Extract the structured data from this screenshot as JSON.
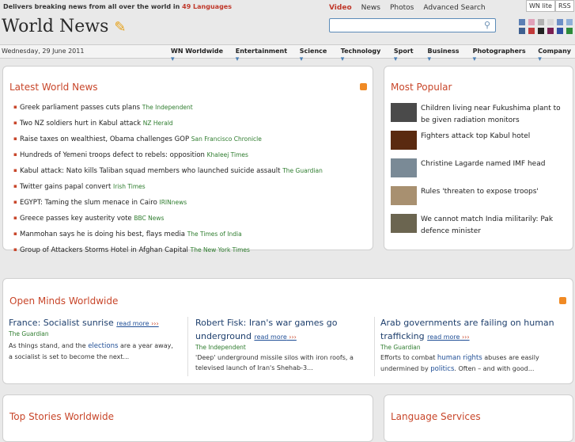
{
  "header": {
    "tagline_prefix": "Delivers breaking news from all over the world in",
    "tagline_highlight": "49 Languages",
    "top_links": [
      "Video",
      "News",
      "Photos",
      "Advanced Search"
    ],
    "lite_label": "WN lite",
    "rss_label": "RSS",
    "logo_text": "World News",
    "search_placeholder": ""
  },
  "theme_swatches": [
    "#5b7fb4",
    "#e0a1b8",
    "#b0b0b0",
    "#d8d8d8",
    "#6d8fc7",
    "#8fb0d8",
    "#3e5f8f",
    "#c23a3a",
    "#222222",
    "#7a1f52",
    "#2f4fa3",
    "#2d8b3a"
  ],
  "nav": {
    "date": "Wednesday, 29 June 2011",
    "items": [
      "WN Worldwide",
      "Entertainment",
      "Science",
      "Technology",
      "Sport",
      "Business",
      "Photographers",
      "Company"
    ]
  },
  "latest": {
    "title": "Latest World News",
    "items": [
      {
        "headline": "Greek parliament passes cuts plans",
        "source": "The Independent"
      },
      {
        "headline": "Two NZ soldiers hurt in Kabul attack",
        "source": "NZ Herald"
      },
      {
        "headline": "Raise taxes on wealthiest, Obama challenges GOP",
        "source": "San Francisco Chronicle"
      },
      {
        "headline": "Hundreds of Yemeni troops defect to rebels: opposition",
        "source": "Khaleej Times"
      },
      {
        "headline": "Kabul attack: Nato kills Taliban squad members who launched suicide assault",
        "source": "The Guardian"
      },
      {
        "headline": "Twitter gains papal convert",
        "source": "Irish Times"
      },
      {
        "headline": "EGYPT: Taming the slum menace in Cairo",
        "source": "IRINnews"
      },
      {
        "headline": "Greece passes key austerity vote",
        "source": "BBC News"
      },
      {
        "headline": "Manmohan says he is doing his best, flays media",
        "source": "The Times of India"
      },
      {
        "headline": "Group of Attackers Storms Hotel in Afghan Capital",
        "source": "The New York Times"
      }
    ]
  },
  "popular": {
    "title": "Most Popular",
    "items": [
      {
        "headline": "Children living near Fukushima plant to be given radiation monitors",
        "thumb_color": "#4a4a4a"
      },
      {
        "headline": "Fighters attack top Kabul hotel",
        "thumb_color": "#5a2a10"
      },
      {
        "headline": "Christine Lagarde named IMF head",
        "thumb_color": "#7a8a96"
      },
      {
        "headline": "Rules 'threaten to expose troops'",
        "thumb_color": "#a89070"
      },
      {
        "headline": "We cannot match India militarily: Pak defence minister",
        "thumb_color": "#6b6550"
      }
    ]
  },
  "open_minds": {
    "title": "Open Minds Worldwide",
    "read_more": "read more",
    "items": [
      {
        "title": "France: Socialist sunrise",
        "source": "The Guardian",
        "text_before": "As things stand, and the ",
        "keyword": "elections",
        "text_after": " are a year away, a socialist is set to become the next..."
      },
      {
        "title": "Robert Fisk: Iran's war games go underground",
        "source": "The Independent",
        "text_before": "'Deep' underground missile silos with iron roofs, a televised launch of Iran's Shehab-3...",
        "keyword": "",
        "text_after": ""
      },
      {
        "title": "Arab governments are failing on human trafficking",
        "source": "The Guardian",
        "text_before": "Efforts to combat ",
        "keyword": "human rights",
        "text_after": " abuses are easily undermined by ",
        "keyword2": "politics",
        "text_after2": ". Often – and with good..."
      }
    ]
  },
  "bottom": {
    "top_stories_title": "Top Stories Worldwide",
    "language_title": "Language Services"
  }
}
